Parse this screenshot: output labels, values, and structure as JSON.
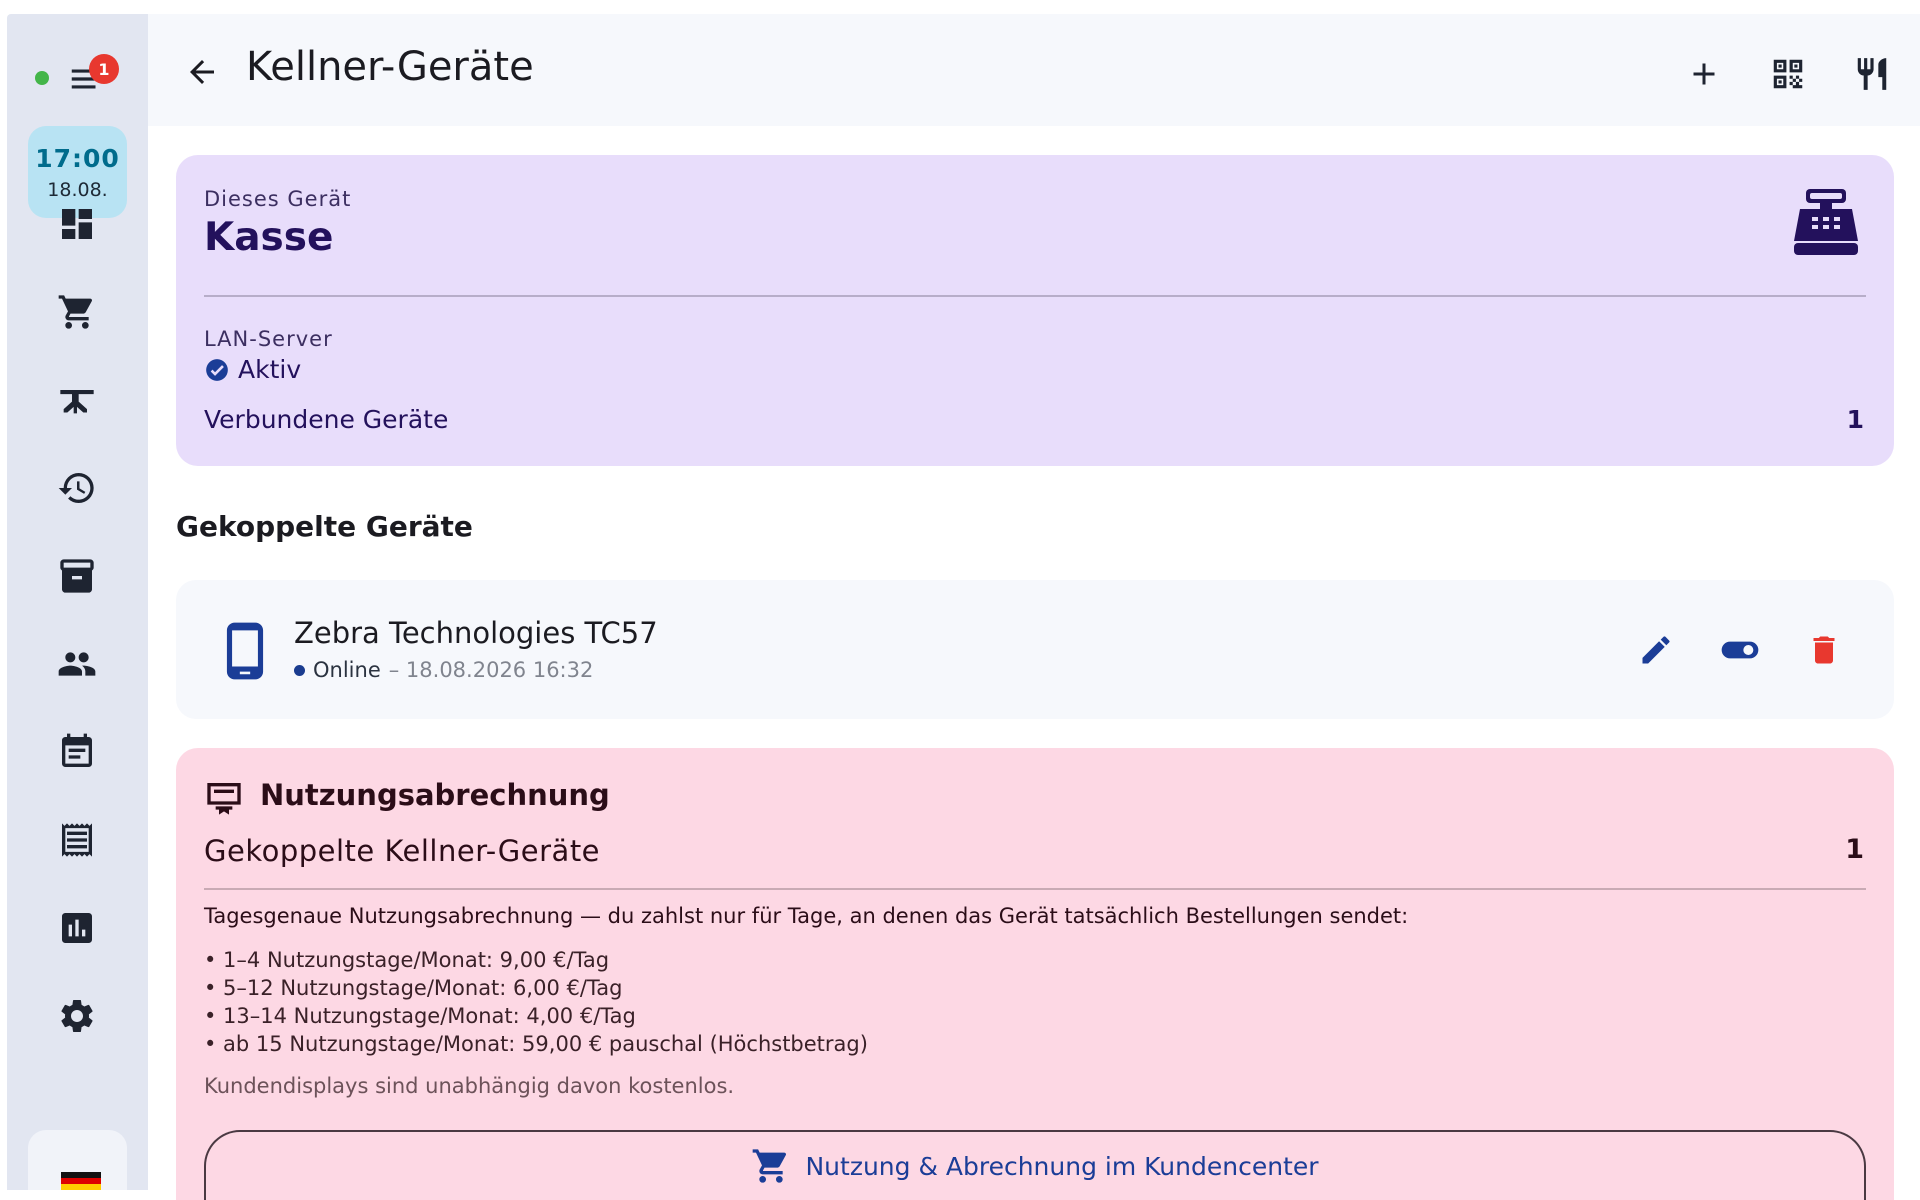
{
  "sidebar": {
    "badge_count": "1",
    "clock_time": "17:00",
    "clock_date": "18.08.",
    "status_color": "#43b549",
    "items": [
      {
        "icon": "dashboard-icon"
      },
      {
        "icon": "cart-icon"
      },
      {
        "icon": "table-icon"
      },
      {
        "icon": "history-icon"
      },
      {
        "icon": "archive-icon"
      },
      {
        "icon": "people-icon"
      },
      {
        "icon": "calendar-icon"
      },
      {
        "icon": "receipt-icon"
      },
      {
        "icon": "chart-icon"
      },
      {
        "icon": "gear-icon"
      }
    ],
    "language_icon": "german-flag-icon"
  },
  "header": {
    "title": "Kellner-Geräte"
  },
  "this_device": {
    "label": "Dieses Gerät",
    "name": "Kasse",
    "lan_label": "LAN-Server",
    "lan_status": "Aktiv",
    "connected_label": "Verbundene Geräte",
    "connected_count": "1"
  },
  "paired": {
    "section_title": "Gekoppelte Geräte",
    "devices": [
      {
        "name": "Zebra Technologies TC57",
        "status": "Online",
        "last_seen": " – 18.08.2026 16:32"
      }
    ]
  },
  "billing": {
    "title": "Nutzungsabrechnung",
    "paired_label": "Gekoppelte Kellner-Geräte",
    "paired_count": "1",
    "description": "Tagesgenaue Nutzungsabrechnung — du zahlst nur für Tage, an denen das Gerät tatsächlich Bestellungen sendet:",
    "tiers": [
      "• 1–4 Nutzungstage/Monat: 9,00 €/Tag",
      "• 5–12 Nutzungstage/Monat: 6,00 €/Tag",
      "• 13–14 Nutzungstage/Monat: 4,00 €/Tag",
      "• ab 15 Nutzungstage/Monat: 59,00 € pauschal (Höchstbetrag)"
    ],
    "note": "Kundendisplays sind unabhängig davon kostenlos.",
    "button_label": "Nutzung & Abrechnung im Kundencenter"
  },
  "colors": {
    "device_card": "#e8ddfb",
    "billing_card": "#fdd8e4",
    "accent_blue": "#1b3d97",
    "delete_red": "#e8382f"
  }
}
